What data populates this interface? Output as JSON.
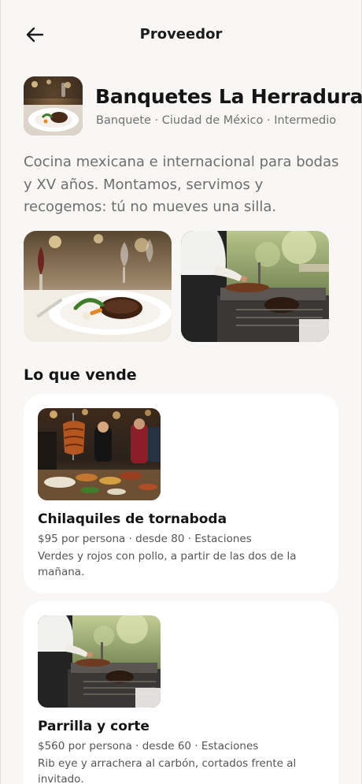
{
  "header": {
    "title": "Proveedor",
    "back_icon": "arrow-left-icon"
  },
  "vendor": {
    "name": "Banquetes La Herradura",
    "meta": "Banquete · Ciudad de México · Intermedio",
    "description": "Cocina mexicana e internacional para bodas y XV años. Montamos, servimos y recogemos: tú no mueves una silla."
  },
  "gallery": [
    {
      "subject": "plated steak dinner at banquet table"
    },
    {
      "subject": "chef grilling at outdoor parrilla"
    }
  ],
  "products_section": {
    "title": "Lo que vende"
  },
  "products": [
    {
      "name": "Chilaquiles de tornaboda",
      "meta": "$95 por persona · desde 80 · Estaciones",
      "description": "Verdes y rojos con pollo, a partir de las dos de la mañana."
    },
    {
      "name": "Parrilla y corte",
      "meta": "$560 por persona · desde 60 · Estaciones",
      "description": "Rib eye y arrachera al carbón, cortados frente al invitado."
    }
  ],
  "colors": {
    "background": "#f8f7f5",
    "card": "#ffffff",
    "text": "#151515",
    "muted": "#6e6e6e"
  }
}
